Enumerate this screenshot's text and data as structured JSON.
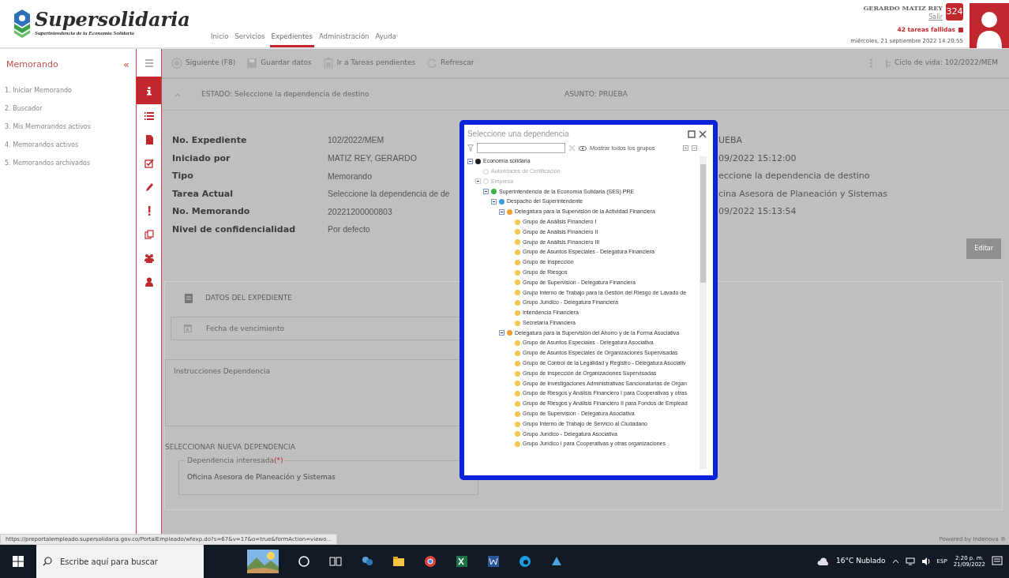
{
  "header": {
    "logo_title": "Supersolidaria",
    "logo_subtitle": "Superintendencia de la Economía Solidaria",
    "nav": [
      {
        "label": "Inicio",
        "selected": false
      },
      {
        "label": "Servicios",
        "selected": false
      },
      {
        "label": "Expedientes",
        "selected": true
      },
      {
        "label": "Administración",
        "selected": false
      },
      {
        "label": "Ayuda",
        "selected": false
      }
    ],
    "user": {
      "name": "GERARDO MATIZ REY",
      "logout": "Salir",
      "badge": "324",
      "failed_tasks": "42 tareas fallidas",
      "datetime": "miércoles, 21 septiembre 2022 14:20:55"
    }
  },
  "sidebar": {
    "title": "Memorando",
    "collapse": "«",
    "items": [
      "1. Iniciar Memorando",
      "2. Buscador",
      "3. Mis Memorandos activos",
      "4. Memorandos activos",
      "5. Memorandos archivados"
    ]
  },
  "icon_rail": [
    {
      "kind": "menu",
      "selected": false
    },
    {
      "kind": "info",
      "selected": true
    },
    {
      "kind": "list",
      "selected": false
    },
    {
      "kind": "file",
      "selected": false
    },
    {
      "kind": "check",
      "selected": false
    },
    {
      "kind": "pencil",
      "selected": false
    },
    {
      "kind": "alert",
      "selected": false
    },
    {
      "kind": "copy",
      "selected": false
    },
    {
      "kind": "users",
      "selected": false
    },
    {
      "kind": "user",
      "selected": false
    }
  ],
  "toolbar": {
    "buttons": [
      {
        "kind": "next",
        "label": "Siguiente (F8)"
      },
      {
        "kind": "save",
        "label": "Guardar datos"
      },
      {
        "kind": "tasks",
        "label": "Ir a Tareas pendientes"
      },
      {
        "kind": "refresh",
        "label": "Refrescar"
      }
    ],
    "lifecycle": "Ciclo de vida: 102/2022/MEM"
  },
  "state_bar": {
    "estado": "ESTADO: Seleccione la dependencia de destino",
    "asunto": "ASUNTO: PRUEBA"
  },
  "details": {
    "rows": [
      {
        "label": "No. Expediente",
        "value": "102/2022/MEM",
        "right_value": "UEBA"
      },
      {
        "label": "Iniciado por",
        "value": "MATIZ REY, GERARDO",
        "right_value": "09/2022 15:12:00"
      },
      {
        "label": "Tipo",
        "value": "Memorando",
        "right_value": "eccione la dependencia de destino"
      },
      {
        "label": "Tarea Actual",
        "value": "Seleccione la dependencia de de",
        "right_value": "cina Asesora de Planeación y Sistemas"
      },
      {
        "label": "No. Memorando",
        "value": "20221200000803",
        "right_value": "09/2022 15:13:54"
      },
      {
        "label": "Nivel de confidencialidad",
        "value": "Por defecto"
      }
    ],
    "edit_button": "Editar"
  },
  "datos": {
    "title": "DATOS DEL EXPEDIENTE",
    "date_placeholder": "Fecha de vencimiento",
    "instructions_placeholder": "Instrucciones Dependencia",
    "section": "SELECCIONAR NUEVA DEPENDENCIA",
    "field_label": "Dependencia interesada",
    "required_mark": "(*)",
    "field_value": "Oficina Asesora de Planeación y Sistemas"
  },
  "dialog": {
    "title": "Seleccione una dependencia",
    "show_all": "Mostrar todos los grupos",
    "tree": [
      {
        "name": "Economía solidaria",
        "color": "#222222",
        "disabled": false,
        "expanded": true,
        "children": [
          {
            "name": "Autoridades de Certificación",
            "color": "#c8c8c8",
            "disabled": true
          },
          {
            "name": "Empresa",
            "color": "#c8c8c8",
            "disabled": true,
            "expanded": true,
            "children": [
              {
                "name": "Superintendencia de la Economía Solidaria (SES) PRE",
                "color": "#3cae4a",
                "disabled": false,
                "expanded": true,
                "children": [
                  {
                    "name": "Despacho del Superintendente",
                    "color": "#3f9ae0",
                    "disabled": false,
                    "expanded": true,
                    "children": [
                      {
                        "name": "Delegatura para la Supervisión de la Actividad Financiera",
                        "color": "#f0a030",
                        "disabled": false,
                        "expanded": true,
                        "children": [
                          {
                            "name": "Grupo de Análisis Financiero I",
                            "color": "#f2c94c",
                            "disabled": false
                          },
                          {
                            "name": "Grupo de Análisis Financiero II",
                            "color": "#f2c94c",
                            "disabled": false
                          },
                          {
                            "name": "Grupo de Análisis Financiero III",
                            "color": "#f2c94c",
                            "disabled": false
                          },
                          {
                            "name": "Grupo de Asuntos Especiales - Delegatura Financiera",
                            "color": "#f2c94c",
                            "disabled": false
                          },
                          {
                            "name": "Grupo de Inspección",
                            "color": "#f2c94c",
                            "disabled": false
                          },
                          {
                            "name": "Grupo de Riesgos",
                            "color": "#f2c94c",
                            "disabled": false
                          },
                          {
                            "name": "Grupo de Supervisión - Delegatura Financiera",
                            "color": "#f2c94c",
                            "disabled": false
                          },
                          {
                            "name": "Grupo Interno de Trabajo para la Gestión del Riesgo de Lavado de",
                            "color": "#f2c94c",
                            "disabled": false
                          },
                          {
                            "name": "Grupo Jurídico - Delegatura Financiera",
                            "color": "#f2c94c",
                            "disabled": false
                          },
                          {
                            "name": "Intendencia Financiera",
                            "color": "#f2c94c",
                            "disabled": false
                          },
                          {
                            "name": "Secretaría Financiera",
                            "color": "#f2c94c",
                            "disabled": false
                          }
                        ]
                      },
                      {
                        "name": "Delegatura para la Supervisión del Ahorro y de la Forma Asociativa",
                        "color": "#f0a030",
                        "disabled": false,
                        "expanded": true,
                        "children": [
                          {
                            "name": "Grupo de Asuntos Especiales - Delegatura Asociativa",
                            "color": "#f2c94c",
                            "disabled": false
                          },
                          {
                            "name": "Grupo de Asuntos Especiales de Organizaciones Supervisadas",
                            "color": "#f2c94c",
                            "disabled": false
                          },
                          {
                            "name": "Grupo de Control de la Legalidad y Registro - Delegatura Asociativ",
                            "color": "#f2c94c",
                            "disabled": false
                          },
                          {
                            "name": "Grupo de Inspección de Organizaciones Supervisadas",
                            "color": "#f2c94c",
                            "disabled": false
                          },
                          {
                            "name": "Grupo de Investigaciones Administrativas Sancionatorias de Organ",
                            "color": "#f2c94c",
                            "disabled": false
                          },
                          {
                            "name": "Grupo de Riesgos y Análisis Financiero I para Cooperativas y otras",
                            "color": "#f2c94c",
                            "disabled": false
                          },
                          {
                            "name": "Grupo de Riesgos y Análisis Financiero II para Fondos de Emplead",
                            "color": "#f2c94c",
                            "disabled": false
                          },
                          {
                            "name": "Grupo de Supervisión - Delegatura Asociativa",
                            "color": "#f2c94c",
                            "disabled": false
                          },
                          {
                            "name": "Grupo Interno de Trabajo de Servicio al Ciudadano",
                            "color": "#f2c94c",
                            "disabled": false
                          },
                          {
                            "name": "Grupo Jurídico - Delegatura Asociativa",
                            "color": "#f2c94c",
                            "disabled": false
                          },
                          {
                            "name": "Grupo Jurídico I para Cooperativas y otras organizaciones",
                            "color": "#f2c94c",
                            "disabled": false
                          }
                        ]
                      }
                    ]
                  }
                ]
              }
            ]
          }
        ]
      }
    ]
  },
  "status_url": "https://preportalempleado.supersolidaria.gov.co/PortalEmpleado/wfexp.do?s=67&v=17&o=true&formAction=viewo...",
  "powered_by": "Powered by Indenova ®",
  "taskbar": {
    "search_placeholder": "Escribe aquí para buscar",
    "weather": "16°C Nublado",
    "language": "ESP",
    "time": "2:20 p. m.",
    "date": "21/09/2022"
  }
}
